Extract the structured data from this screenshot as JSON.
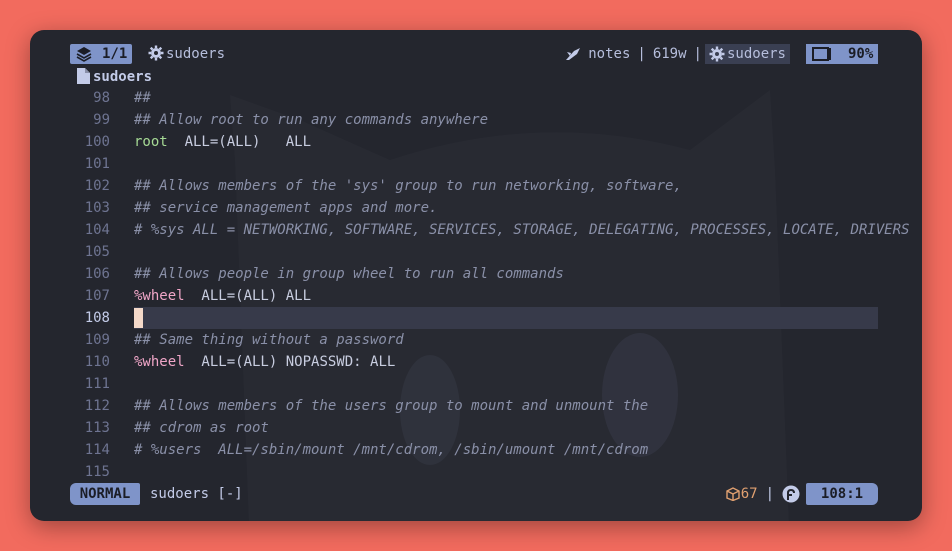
{
  "colors": {
    "wallpaper": "#f26b5e",
    "window_bg": "#24262e",
    "accent_pill": "#7f94c9",
    "comment": "#8a90a8",
    "keyword": "#a6da95",
    "group": "#f0a6c8",
    "cursor": "#f4d9c9"
  },
  "topbar": {
    "tab_icon": "layers-icon",
    "tab_counter": "1/1",
    "buffer_name": "sudoers",
    "mode_icon": "pencil-feather-icon",
    "notes_label": "notes",
    "word_count": "619w",
    "right_buffer_name": "sudoers",
    "zoom_icon": "window-icon",
    "zoom_level": "90%"
  },
  "winbar": {
    "file_icon": "file-icon",
    "filename": "sudoers"
  },
  "editor": {
    "lines": [
      {
        "n": "98",
        "text": "##"
      },
      {
        "n": "99",
        "text": "## Allow root to run any commands anywhere"
      },
      {
        "n": "100",
        "p1": "root",
        "p2": "  ALL=(ALL)   ALL"
      },
      {
        "n": "101",
        "text": ""
      },
      {
        "n": "102",
        "text": "## Allows members of the 'sys' group to run networking, software,"
      },
      {
        "n": "103",
        "text": "## service management apps and more."
      },
      {
        "n": "104",
        "text": "# %sys ALL = NETWORKING, SOFTWARE, SERVICES, STORAGE, DELEGATING, PROCESSES, LOCATE, DRIVERS"
      },
      {
        "n": "105",
        "text": ""
      },
      {
        "n": "106",
        "text": "## Allows people in group wheel to run all commands"
      },
      {
        "n": "107",
        "p1": "%wheel",
        "p2": "  ALL=(ALL) ALL"
      },
      {
        "n": "108",
        "text": ""
      },
      {
        "n": "109",
        "text": "## Same thing without a password"
      },
      {
        "n": "110",
        "p1": "%wheel",
        "p2": "  ALL=(ALL) NOPASSWD: ALL"
      },
      {
        "n": "111",
        "text": ""
      },
      {
        "n": "112",
        "text": "## Allows members of the users group to mount and unmount the"
      },
      {
        "n": "113",
        "text": "## cdrom as root"
      },
      {
        "n": "114",
        "text": "# %users  ALL=/sbin/mount /mnt/cdrom, /sbin/umount /mnt/cdrom"
      },
      {
        "n": "115",
        "text": ""
      }
    ],
    "cursor_line": "108"
  },
  "statusbar": {
    "mode": "NORMAL",
    "file_status": "sudoers [-]",
    "package_icon": "package-icon",
    "package_count": "67",
    "os_icon": "fedora-icon",
    "position": "108:1"
  }
}
